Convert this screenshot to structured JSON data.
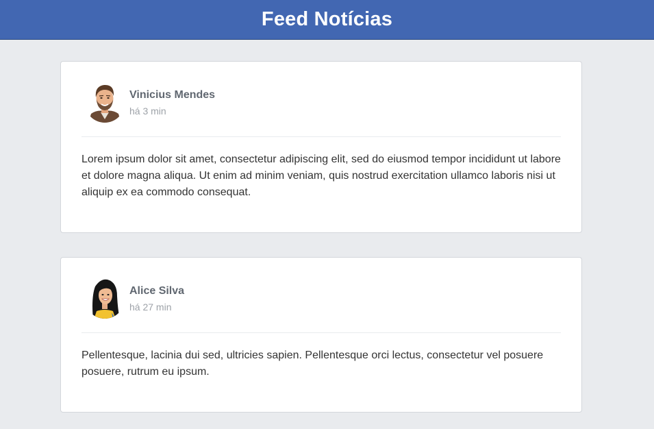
{
  "header": {
    "title": "Feed Notícias"
  },
  "posts": [
    {
      "author": "Vinicius Mendes",
      "time": "há 3 min",
      "avatar_icon": "man-avatar-icon",
      "content": "Lorem ipsum dolor sit amet, consectetur adipiscing elit, sed do eiusmod tempor incididunt ut labore et dolore magna aliqua. Ut enim ad minim veniam, quis nostrud exercitation ullamco laboris nisi ut aliquip ex ea commodo consequat."
    },
    {
      "author": "Alice Silva",
      "time": "há 27 min",
      "avatar_icon": "woman-avatar-icon",
      "content": "Pellentesque, lacinia dui sed, ultricies sapien. Pellentesque orci lectus, consectetur vel posuere posuere, rutrum eu ipsum."
    }
  ],
  "colors": {
    "header_bg": "#4267b2",
    "page_bg": "#e9ebee",
    "card_bg": "#ffffff"
  }
}
